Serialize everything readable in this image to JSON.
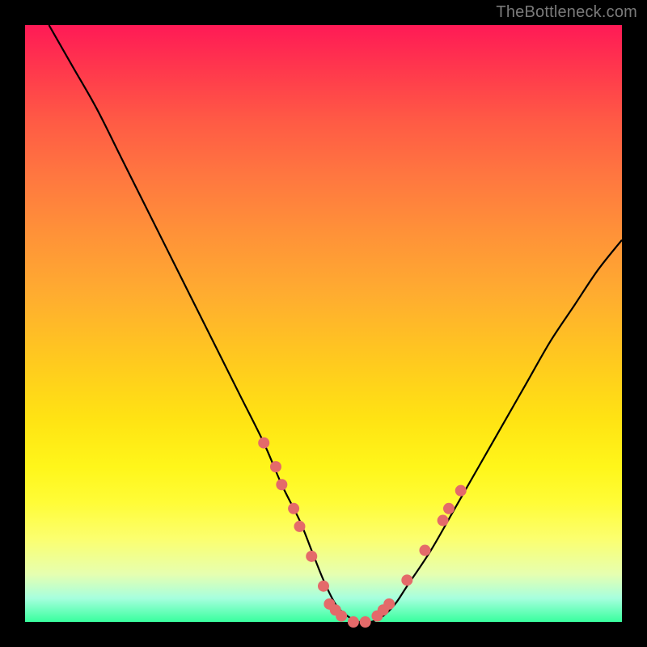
{
  "attribution": "TheBottleneck.com",
  "chart_data": {
    "type": "line",
    "title": "",
    "xlabel": "",
    "ylabel": "",
    "xlim": [
      0,
      100
    ],
    "ylim": [
      0,
      100
    ],
    "grid": false,
    "legend": false,
    "series": [
      {
        "name": "curve",
        "color": "#000000",
        "x": [
          4,
          8,
          12,
          16,
          20,
          24,
          28,
          32,
          36,
          40,
          43,
          46,
          48,
          50,
          52,
          54,
          56,
          58,
          60,
          62,
          64,
          68,
          72,
          76,
          80,
          84,
          88,
          92,
          96,
          100
        ],
        "y": [
          100,
          93,
          86,
          78,
          70,
          62,
          54,
          46,
          38,
          30,
          23,
          17,
          12,
          7,
          3,
          1,
          0,
          0,
          1,
          3,
          6,
          12,
          19,
          26,
          33,
          40,
          47,
          53,
          59,
          64
        ]
      }
    ],
    "markers": [
      {
        "name": "red-dots",
        "color": "#e46a6a",
        "radius_px": 7,
        "points": [
          {
            "x": 40,
            "y": 30
          },
          {
            "x": 42,
            "y": 26
          },
          {
            "x": 43,
            "y": 23
          },
          {
            "x": 45,
            "y": 19
          },
          {
            "x": 46,
            "y": 16
          },
          {
            "x": 48,
            "y": 11
          },
          {
            "x": 50,
            "y": 6
          },
          {
            "x": 51,
            "y": 3
          },
          {
            "x": 52,
            "y": 2
          },
          {
            "x": 53,
            "y": 1
          },
          {
            "x": 55,
            "y": 0
          },
          {
            "x": 57,
            "y": 0
          },
          {
            "x": 59,
            "y": 1
          },
          {
            "x": 60,
            "y": 2
          },
          {
            "x": 61,
            "y": 3
          },
          {
            "x": 64,
            "y": 7
          },
          {
            "x": 67,
            "y": 12
          },
          {
            "x": 70,
            "y": 17
          },
          {
            "x": 71,
            "y": 19
          },
          {
            "x": 73,
            "y": 22
          }
        ]
      }
    ]
  }
}
